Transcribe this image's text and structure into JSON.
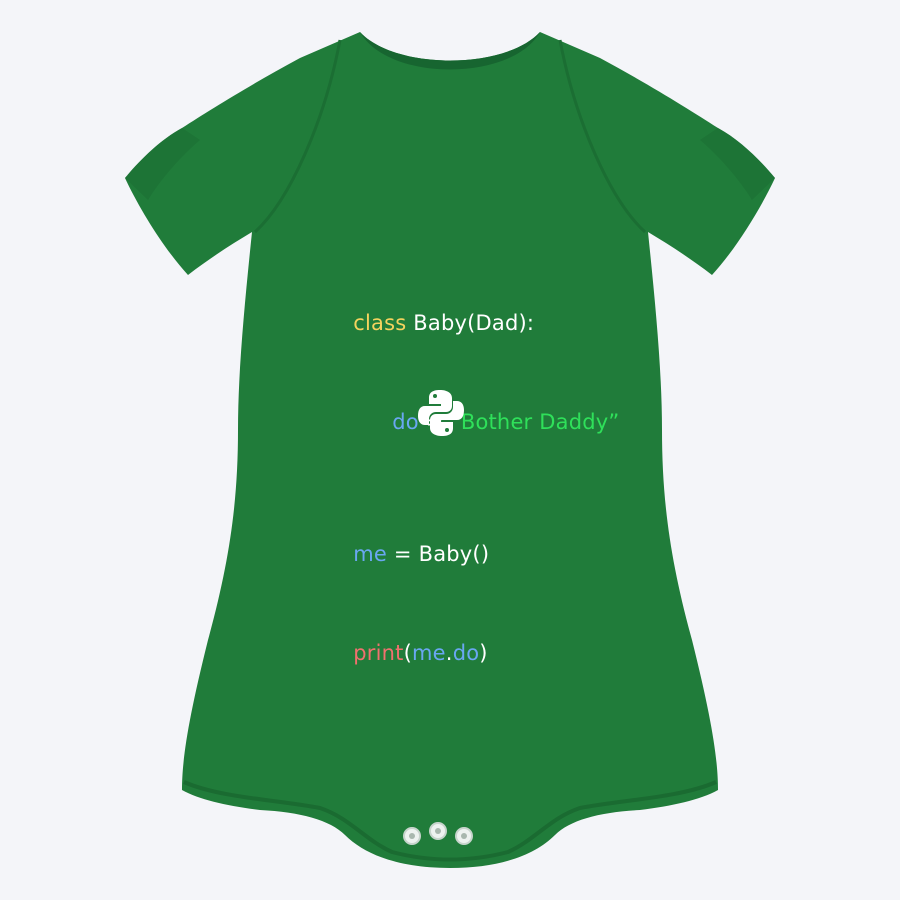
{
  "garment": {
    "type": "baby-onesie",
    "color": "#207c3a",
    "background": "#f4f5f9"
  },
  "code": {
    "lines": [
      [
        {
          "text": "class",
          "role": "keyword"
        },
        {
          "text": " Baby(Dad):",
          "role": "plain"
        }
      ],
      [
        {
          "text": "do",
          "role": "var"
        },
        {
          "text": " = ",
          "role": "plain"
        },
        {
          "text": "“Bother Daddy”",
          "role": "string"
        }
      ],
      [
        {
          "text": "me",
          "role": "var"
        },
        {
          "text": " = Baby()",
          "role": "plain"
        }
      ],
      [
        {
          "text": "print",
          "role": "builtin"
        },
        {
          "text": "(",
          "role": "plain"
        },
        {
          "text": "me",
          "role": "var"
        },
        {
          "text": ".",
          "role": "plain"
        },
        {
          "text": "do",
          "role": "var"
        },
        {
          "text": ")",
          "role": "plain"
        }
      ]
    ],
    "colors": {
      "keyword": "#f4d35e",
      "plain": "#ffffff",
      "var": "#6aa7f2",
      "string": "#2fe05a",
      "builtin": "#f0716f"
    }
  },
  "logo": {
    "icon": "python-logo-icon",
    "color": "#ffffff"
  }
}
